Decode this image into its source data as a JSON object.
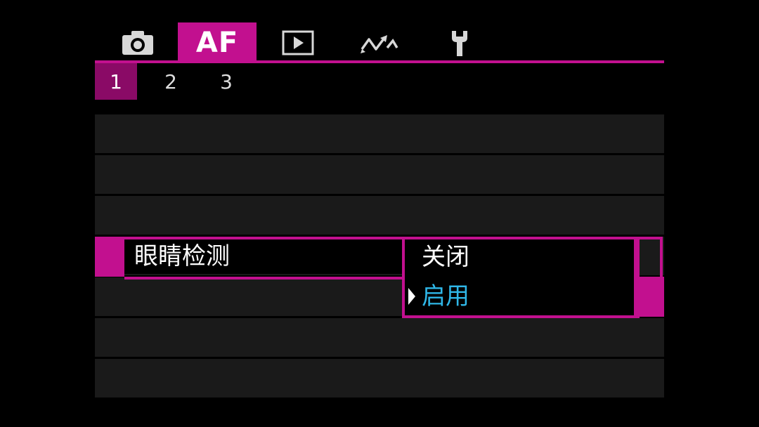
{
  "tabs": [
    {
      "name": "camera-icon",
      "label": ""
    },
    {
      "name": "af",
      "label": "AF"
    },
    {
      "name": "playback-icon",
      "label": ""
    },
    {
      "name": "wireless-icon",
      "label": ""
    },
    {
      "name": "wrench-icon",
      "label": ""
    }
  ],
  "active_tab": "AF",
  "pages": [
    "1",
    "2",
    "3"
  ],
  "active_page": "1",
  "setting": {
    "label": "眼睛检测",
    "options": [
      "关闭",
      "启用"
    ],
    "highlighted_option": "启用"
  },
  "colors": {
    "accent": "#c2108f",
    "page_active": "#8a0a66",
    "row_bg": "#1a1a1a",
    "selected_text": "#2fb7e8"
  }
}
